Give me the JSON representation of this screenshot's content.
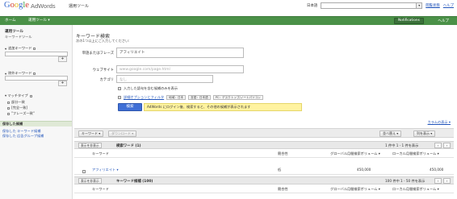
{
  "header": {
    "logo_google": "Google",
    "logo_product": "AdWords",
    "account_label": "運用ツール",
    "account_menu": "▾",
    "language_label": "日本語",
    "language_value": "",
    "links": [
      "閲覧状態",
      "ヘルプ"
    ]
  },
  "nav": {
    "items": [
      "ホーム",
      "運用ツール ▾"
    ],
    "notifications": "Notifications",
    "help": "ヘルプ"
  },
  "sidebar": {
    "heading": "運用ツール",
    "subheading": "キーワードツール",
    "include_label": "追加キーワード",
    "exclude_label": "除外キーワード",
    "add_button": "+",
    "match_type_label": "▾ マッチタイプ",
    "match_types": [
      "部分一致",
      "[完全一致]",
      "\"フレーズ一致\""
    ],
    "saved_heading": "保存した候補",
    "saved_links": [
      "保存した キーワード候補",
      "保存した 広告グループ候補"
    ]
  },
  "form": {
    "title": "キーワード検索",
    "description": "次の1つ以上にご入力してください:",
    "word_label": "単語またはフレーズ",
    "word_value": "アフィリエイト",
    "website_label": "ウェブサイト",
    "website_placeholder": "www.google.com/page.html",
    "category_label": "カテゴリ",
    "category_value": "なし",
    "checkbox_label": "入力した語句を含む候補のみを表示",
    "advanced_link": "詳細オプションとフィルタ",
    "filter_tags": [
      "地域：日本",
      "言語：日本語",
      "PC：デスクトップ/ノートパソコン"
    ],
    "search_button": "検索",
    "notice": "AdWords にログイン後、検索すると、その他の候補が表示されます"
  },
  "results": {
    "columns_link": "カラムの表示 ▾",
    "toolbar": {
      "add_keyword": "キーワード ▾",
      "download": "ダウンロード ▾",
      "sort": "並べ替え ▾",
      "options": "列を表示 ▾"
    },
    "search_terms_group": {
      "hide": "表示を非表示",
      "title": "検索ワード (1)",
      "range": "1 件中 1 - 1 件を表示",
      "prev": "‹",
      "next": "›"
    },
    "headers": [
      "キーワード",
      "競合性",
      "グローバル月間検索ボリューム ▾",
      "ローカル月間検索ボリューム ▾"
    ],
    "rows": [
      {
        "keyword": "アフィリエイト ▾",
        "competition": "低",
        "global": "450,000",
        "local": "450,000"
      }
    ],
    "ideas_group": {
      "hide": "表示を非表示",
      "title": "キーワード候補 (100)",
      "range": "100 件中 1 - 50 件を表示",
      "prev": "‹",
      "next": "›"
    },
    "headers2": [
      "キーワード",
      "競合性",
      "グローバル月間検索ボリューム ▾",
      "ローカル月間検索ボリューム ▾"
    ]
  }
}
